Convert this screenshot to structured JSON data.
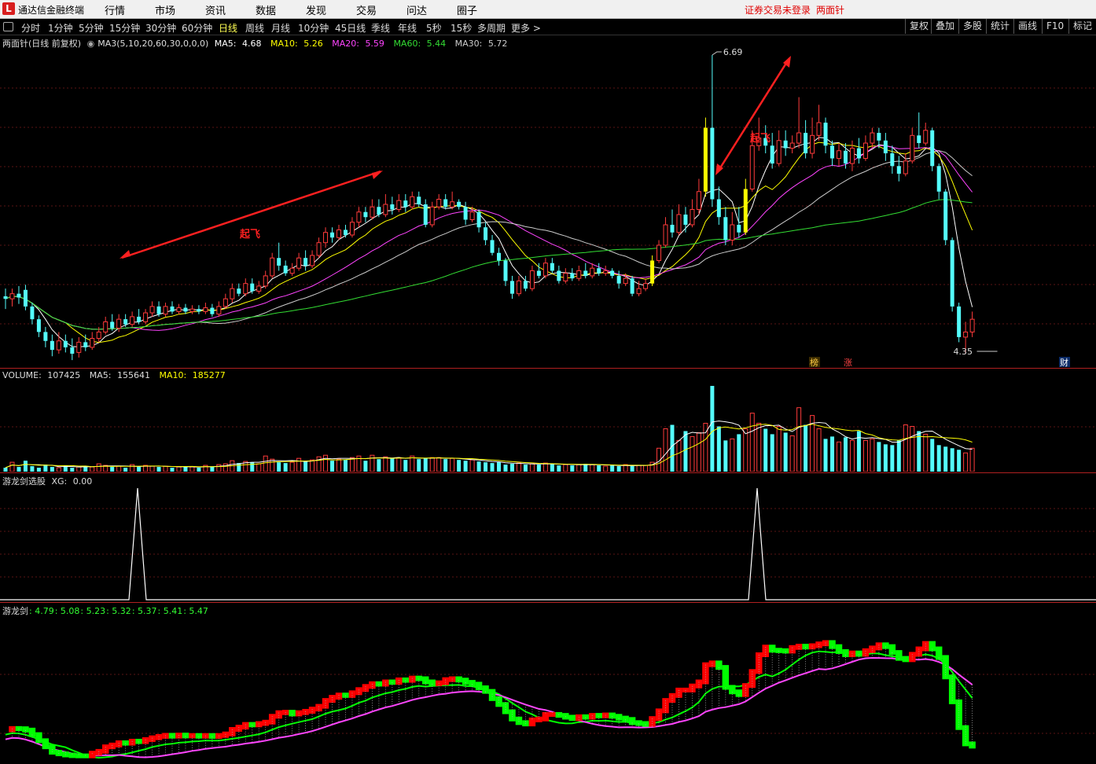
{
  "app": {
    "title": "通达信金融终端",
    "logo_glyph": "L",
    "menu": [
      "行情",
      "市场",
      "资讯",
      "数据",
      "发现",
      "交易",
      "问达",
      "圈子"
    ],
    "login_status": "证券交易未登录",
    "stock_name": "两面针"
  },
  "toolbar": {
    "periods": [
      "分时",
      "1分钟",
      "5分钟",
      "15分钟",
      "30分钟",
      "60分钟",
      "日线",
      "周线",
      "月线",
      "10分钟",
      "45日线",
      "季线",
      "年线",
      "5秒",
      "15秒",
      "多周期",
      "更多 >"
    ],
    "active": "日线",
    "right_buttons": [
      "复权",
      "叠加",
      "多股",
      "统计",
      "画线",
      "F10",
      "标记"
    ]
  },
  "kline_header": {
    "name": "两面针",
    "mode": "(日线 前复权)",
    "ma_params": "MA3(5,10,20,60,30,0,0,0)",
    "ma": [
      {
        "label": "MA5:",
        "value": "4.68",
        "color": "#ffffff"
      },
      {
        "label": "MA10:",
        "value": "5.26",
        "color": "#ffff00"
      },
      {
        "label": "MA20:",
        "value": "5.59",
        "color": "#ff44ff"
      },
      {
        "label": "MA60:",
        "value": "5.44",
        "color": "#33dd33"
      },
      {
        "label": "MA30:",
        "value": "5.72",
        "color": "#cccccc"
      }
    ]
  },
  "annotations": {
    "takeoff_label": "起飞",
    "high_label": "6.69",
    "low_label": "4.35",
    "badge_list": "榜",
    "badge_up": "涨",
    "badge_fin": "财"
  },
  "volume_header": {
    "name": "VOLUME:",
    "value": "107425",
    "ma5_label": "MA5:",
    "ma5": "155641",
    "ma10_label": "MA10:",
    "ma10": "185277"
  },
  "xg_header": {
    "name": "游龙剑选股",
    "label": "XG:",
    "value": "0.00"
  },
  "dragon_header": {
    "name": "游龙剑",
    "values": [
      ": 4.79",
      ": 5.08",
      ": 5.23",
      ": 5.32",
      ": 5.37",
      ": 5.41",
      ": 5.47"
    ]
  },
  "chart_data": {
    "type": "candlestick",
    "price_range": [
      4.35,
      6.69
    ],
    "candles": [
      [
        4.8,
        4.78,
        4.86,
        4.7
      ],
      [
        4.78,
        4.82,
        4.86,
        4.72
      ],
      [
        4.82,
        4.79,
        4.88,
        4.74
      ],
      [
        4.85,
        4.72,
        4.89,
        4.69
      ],
      [
        4.72,
        4.62,
        4.75,
        4.58
      ],
      [
        4.62,
        4.52,
        4.65,
        4.48
      ],
      [
        4.52,
        4.45,
        4.56,
        4.4
      ],
      [
        4.45,
        4.38,
        4.5,
        4.33
      ],
      [
        4.38,
        4.45,
        4.52,
        4.35
      ],
      [
        4.45,
        4.4,
        4.5,
        4.36
      ],
      [
        4.4,
        4.35,
        4.47,
        4.3
      ],
      [
        4.36,
        4.44,
        4.48,
        4.32
      ],
      [
        4.44,
        4.4,
        4.5,
        4.37
      ],
      [
        4.4,
        4.47,
        4.52,
        4.38
      ],
      [
        4.47,
        4.52,
        4.56,
        4.44
      ],
      [
        4.52,
        4.6,
        4.64,
        4.5
      ],
      [
        4.6,
        4.55,
        4.66,
        4.53
      ],
      [
        4.55,
        4.62,
        4.66,
        4.52
      ],
      [
        4.62,
        4.58,
        4.66,
        4.56
      ],
      [
        4.58,
        4.64,
        4.68,
        4.56
      ],
      [
        4.64,
        4.6,
        4.7,
        4.58
      ],
      [
        4.6,
        4.67,
        4.7,
        4.58
      ],
      [
        4.67,
        4.72,
        4.76,
        4.64
      ],
      [
        4.72,
        4.66,
        4.76,
        4.64
      ],
      [
        4.66,
        4.72,
        4.75,
        4.64
      ],
      [
        4.72,
        4.68,
        4.76,
        4.66
      ],
      [
        4.68,
        4.71,
        4.74,
        4.66
      ],
      [
        4.71,
        4.68,
        4.74,
        4.66
      ],
      [
        4.68,
        4.7,
        4.73,
        4.66
      ],
      [
        4.7,
        4.68,
        4.73,
        4.66
      ],
      [
        4.68,
        4.71,
        4.75,
        4.66
      ],
      [
        4.71,
        4.66,
        4.74,
        4.64
      ],
      [
        4.66,
        4.72,
        4.76,
        4.64
      ],
      [
        4.72,
        4.78,
        4.82,
        4.7
      ],
      [
        4.78,
        4.86,
        4.9,
        4.75
      ],
      [
        4.86,
        4.82,
        4.9,
        4.8
      ],
      [
        4.82,
        4.9,
        4.94,
        4.8
      ],
      [
        4.9,
        4.84,
        4.94,
        4.82
      ],
      [
        4.84,
        4.88,
        4.92,
        4.82
      ],
      [
        4.88,
        4.96,
        5.0,
        4.86
      ],
      [
        4.96,
        5.1,
        5.14,
        4.94
      ],
      [
        5.1,
        5.04,
        5.22,
        5.0
      ],
      [
        5.04,
        4.98,
        5.08,
        4.96
      ],
      [
        4.98,
        5.02,
        5.06,
        4.96
      ],
      [
        5.02,
        5.1,
        5.14,
        5.0
      ],
      [
        5.1,
        5.04,
        5.16,
        5.0
      ],
      [
        5.04,
        5.12,
        5.16,
        5.02
      ],
      [
        5.12,
        5.22,
        5.26,
        5.1
      ],
      [
        5.22,
        5.3,
        5.34,
        5.18
      ],
      [
        5.3,
        5.26,
        5.34,
        5.22
      ],
      [
        5.26,
        5.32,
        5.36,
        5.24
      ],
      [
        5.32,
        5.28,
        5.36,
        5.26
      ],
      [
        5.28,
        5.38,
        5.42,
        5.26
      ],
      [
        5.38,
        5.46,
        5.5,
        5.34
      ],
      [
        5.46,
        5.42,
        5.5,
        5.38
      ],
      [
        5.42,
        5.5,
        5.56,
        5.4
      ],
      [
        5.5,
        5.44,
        5.56,
        5.42
      ],
      [
        5.44,
        5.52,
        5.6,
        5.42
      ],
      [
        5.52,
        5.48,
        5.58,
        5.44
      ],
      [
        5.48,
        5.55,
        5.6,
        5.46
      ],
      [
        5.55,
        5.5,
        5.6,
        5.46
      ],
      [
        5.5,
        5.58,
        5.62,
        5.48
      ],
      [
        5.58,
        5.52,
        5.62,
        5.5
      ],
      [
        5.52,
        5.36,
        5.56,
        5.34
      ],
      [
        5.36,
        5.5,
        5.54,
        5.34
      ],
      [
        5.5,
        5.56,
        5.6,
        5.48
      ],
      [
        5.56,
        5.5,
        5.6,
        5.48
      ],
      [
        5.5,
        5.54,
        5.62,
        5.48
      ],
      [
        5.54,
        5.5,
        5.56,
        5.48
      ],
      [
        5.5,
        5.4,
        5.54,
        5.36
      ],
      [
        5.4,
        5.46,
        5.5,
        5.38
      ],
      [
        5.46,
        5.34,
        5.48,
        5.3
      ],
      [
        5.34,
        5.24,
        5.38,
        5.2
      ],
      [
        5.24,
        5.14,
        5.28,
        5.12
      ],
      [
        5.14,
        5.08,
        5.18,
        5.04
      ],
      [
        5.08,
        4.92,
        5.1,
        4.88
      ],
      [
        4.92,
        4.82,
        4.96,
        4.78
      ],
      [
        4.82,
        4.92,
        4.96,
        4.8
      ],
      [
        4.92,
        4.86,
        4.96,
        4.84
      ],
      [
        4.86,
        5.0,
        5.04,
        4.84
      ],
      [
        5.0,
        4.96,
        5.06,
        4.94
      ],
      [
        4.96,
        5.06,
        5.1,
        4.94
      ],
      [
        5.06,
        5.0,
        5.1,
        4.98
      ],
      [
        5.0,
        4.92,
        5.04,
        4.9
      ],
      [
        4.92,
        4.98,
        5.02,
        4.9
      ],
      [
        4.98,
        4.94,
        5.02,
        4.92
      ],
      [
        4.94,
        5.0,
        5.04,
        4.92
      ],
      [
        5.0,
        4.96,
        5.06,
        4.94
      ],
      [
        4.96,
        5.02,
        5.06,
        4.94
      ],
      [
        5.02,
        4.98,
        5.06,
        4.96
      ],
      [
        4.98,
        5.0,
        5.04,
        4.96
      ],
      [
        5.0,
        4.96,
        5.02,
        4.94
      ],
      [
        4.96,
        4.9,
        5.0,
        4.86
      ],
      [
        4.9,
        4.94,
        4.98,
        4.88
      ],
      [
        4.94,
        4.82,
        4.96,
        4.8
      ],
      [
        4.82,
        4.86,
        4.92,
        4.8
      ],
      [
        4.86,
        4.9,
        4.94,
        4.84
      ],
      [
        4.9,
        5.08,
        5.12,
        4.88
      ],
      [
        5.08,
        5.2,
        5.24,
        5.06
      ],
      [
        5.2,
        5.36,
        5.42,
        5.18
      ],
      [
        5.36,
        5.3,
        5.48,
        5.26
      ],
      [
        5.3,
        5.44,
        5.52,
        5.28
      ],
      [
        5.44,
        5.36,
        5.5,
        5.3
      ],
      [
        5.36,
        5.48,
        5.56,
        5.34
      ],
      [
        5.48,
        5.62,
        5.72,
        5.44
      ],
      [
        5.62,
        6.12,
        6.2,
        5.58
      ],
      [
        6.12,
        5.56,
        6.69,
        5.5
      ],
      [
        5.56,
        5.42,
        5.66,
        5.36
      ],
      [
        5.42,
        5.24,
        5.5,
        5.2
      ],
      [
        5.24,
        5.36,
        5.46,
        5.2
      ],
      [
        5.36,
        5.3,
        5.5,
        5.26
      ],
      [
        5.3,
        5.64,
        5.72,
        5.28
      ],
      [
        5.64,
        5.98,
        6.1,
        5.62
      ],
      [
        5.98,
        6.04,
        6.2,
        5.94
      ],
      [
        6.04,
        5.98,
        6.14,
        5.92
      ],
      [
        5.98,
        5.84,
        6.08,
        5.8
      ],
      [
        5.84,
        6.02,
        6.1,
        5.82
      ],
      [
        6.02,
        5.96,
        6.1,
        5.9
      ],
      [
        5.96,
        6.0,
        6.06,
        5.92
      ],
      [
        6.0,
        6.08,
        6.36,
        5.96
      ],
      [
        6.08,
        5.92,
        6.18,
        5.88
      ],
      [
        5.92,
        6.06,
        6.2,
        5.88
      ],
      [
        6.06,
        6.16,
        6.3,
        6.02
      ],
      [
        6.16,
        5.98,
        6.2,
        5.92
      ],
      [
        5.98,
        5.88,
        6.02,
        5.82
      ],
      [
        5.88,
        5.94,
        6.0,
        5.82
      ],
      [
        5.94,
        5.84,
        6.0,
        5.8
      ],
      [
        5.84,
        5.96,
        6.02,
        5.78
      ],
      [
        5.96,
        5.88,
        6.04,
        5.84
      ],
      [
        5.88,
        6.0,
        6.06,
        5.86
      ],
      [
        6.0,
        6.08,
        6.12,
        5.96
      ],
      [
        6.08,
        6.02,
        6.12,
        5.96
      ],
      [
        6.02,
        5.92,
        6.08,
        5.86
      ],
      [
        5.92,
        5.82,
        5.98,
        5.76
      ],
      [
        5.82,
        5.76,
        5.9,
        5.7
      ],
      [
        5.76,
        5.86,
        5.92,
        5.74
      ],
      [
        5.86,
        6.06,
        6.12,
        5.84
      ],
      [
        6.06,
        6.0,
        6.24,
        5.96
      ],
      [
        6.0,
        6.1,
        6.16,
        5.98
      ],
      [
        6.1,
        5.82,
        6.12,
        5.78
      ],
      [
        5.82,
        5.62,
        5.84,
        5.56
      ],
      [
        5.62,
        5.24,
        5.64,
        5.2
      ],
      [
        5.24,
        4.72,
        5.26,
        4.68
      ],
      [
        4.72,
        4.48,
        4.75,
        4.44
      ],
      [
        4.48,
        4.52,
        4.6,
        4.35
      ],
      [
        4.52,
        4.62,
        4.68,
        4.48
      ]
    ],
    "volume": [
      5,
      12,
      6,
      14,
      7,
      5,
      9,
      6,
      5,
      8,
      5,
      6,
      7,
      6,
      10,
      8,
      6,
      7,
      5,
      9,
      6,
      8,
      7,
      6,
      7,
      5,
      6,
      7,
      6,
      5,
      8,
      6,
      9,
      10,
      14,
      11,
      13,
      12,
      10,
      20,
      16,
      12,
      11,
      12,
      17,
      13,
      15,
      19,
      21,
      14,
      16,
      15,
      18,
      20,
      14,
      21,
      16,
      19,
      17,
      18,
      15,
      20,
      16,
      17,
      18,
      18,
      16,
      17,
      15,
      14,
      15,
      13,
      12,
      11,
      12,
      9,
      10,
      11,
      9,
      10,
      9,
      11,
      10,
      8,
      9,
      8,
      9,
      10,
      9,
      8,
      7,
      8,
      7,
      9,
      7,
      8,
      8,
      12,
      30,
      55,
      60,
      40,
      52,
      45,
      50,
      62,
      110,
      58,
      40,
      42,
      48,
      55,
      75,
      62,
      55,
      48,
      58,
      50,
      46,
      82,
      60,
      72,
      55,
      42,
      45,
      38,
      44,
      40,
      52,
      40,
      42,
      38,
      35,
      34,
      40,
      60,
      58,
      52,
      48,
      42,
      34,
      32,
      30,
      28,
      24,
      30
    ],
    "ma_values": {
      "MA5": 4.68,
      "MA10": 5.26,
      "MA20": 5.59,
      "MA60": 5.44,
      "MA30": 5.72
    },
    "xg_signals": [
      28,
      158
    ],
    "dragon_values": [
      4.79,
      5.08,
      5.23,
      5.32,
      5.37,
      5.41,
      5.47
    ]
  },
  "colors": {
    "up": "#ff3b3b",
    "down": "#54fcfc",
    "yellow_bar": "#ffff00",
    "grid": "#5a1515",
    "ma5": "#ffffff",
    "ma10": "#ffff00",
    "ma20": "#ff44ff",
    "ma60": "#33dd33",
    "ma30": "#cccccc",
    "dragon_up": "#ff0000",
    "dragon_down": "#00ff00",
    "dragon_ma": "#ff44ff"
  }
}
